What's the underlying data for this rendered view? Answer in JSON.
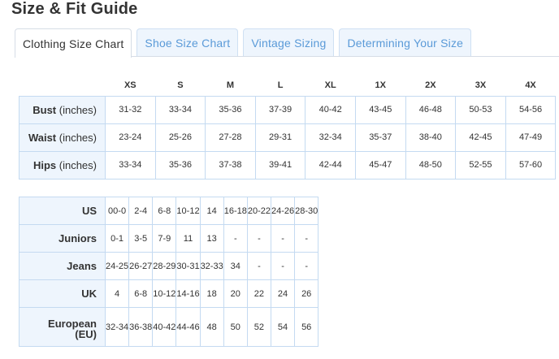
{
  "page": {
    "title": "Size & Fit Guide"
  },
  "tabs": [
    {
      "label": "Clothing Size Chart",
      "active": true
    },
    {
      "label": "Shoe Size Chart",
      "active": false
    },
    {
      "label": "Vintage Sizing",
      "active": false
    },
    {
      "label": "Determining Your Size",
      "active": false
    }
  ],
  "size_chart": {
    "columns": [
      "XS",
      "S",
      "M",
      "L",
      "XL",
      "1X",
      "2X",
      "3X",
      "4X"
    ],
    "rows": [
      {
        "label": "Bust",
        "unit": " (inches)",
        "values": [
          "31-32",
          "33-34",
          "35-36",
          "37-39",
          "40-42",
          "43-45",
          "46-48",
          "50-53",
          "54-56"
        ]
      },
      {
        "label": "Waist",
        "unit": " (inches)",
        "values": [
          "23-24",
          "25-26",
          "27-28",
          "29-31",
          "32-34",
          "35-37",
          "38-40",
          "42-45",
          "47-49"
        ]
      },
      {
        "label": "Hips",
        "unit": " (inches)",
        "values": [
          "33-34",
          "35-36",
          "37-38",
          "39-41",
          "42-44",
          "45-47",
          "48-50",
          "52-55",
          "57-60"
        ]
      }
    ]
  },
  "conversion_chart": {
    "rows": [
      {
        "label": "US",
        "values": [
          "00-0",
          "2-4",
          "6-8",
          "10-12",
          "14",
          "16-18",
          "20-22",
          "24-26",
          "28-30"
        ]
      },
      {
        "label": "Juniors",
        "values": [
          "0-1",
          "3-5",
          "7-9",
          "11",
          "13",
          "-",
          "-",
          "-",
          "-"
        ]
      },
      {
        "label": "Jeans",
        "values": [
          "24-25",
          "26-27",
          "28-29",
          "30-31",
          "32-33",
          "34",
          "-",
          "-",
          "-"
        ]
      },
      {
        "label": "UK",
        "values": [
          "4",
          "6-8",
          "10-12",
          "14-16",
          "18",
          "20",
          "22",
          "24",
          "26"
        ]
      },
      {
        "label": "European",
        "label_line2": "(EU)",
        "values": [
          "32-34",
          "36-38",
          "40-42",
          "44-46",
          "48",
          "50",
          "52",
          "54",
          "56"
        ]
      }
    ]
  },
  "colors": {
    "label_bg": "#eef5fd",
    "border": "#c4daf1",
    "tab_link": "#5a9ad8"
  }
}
